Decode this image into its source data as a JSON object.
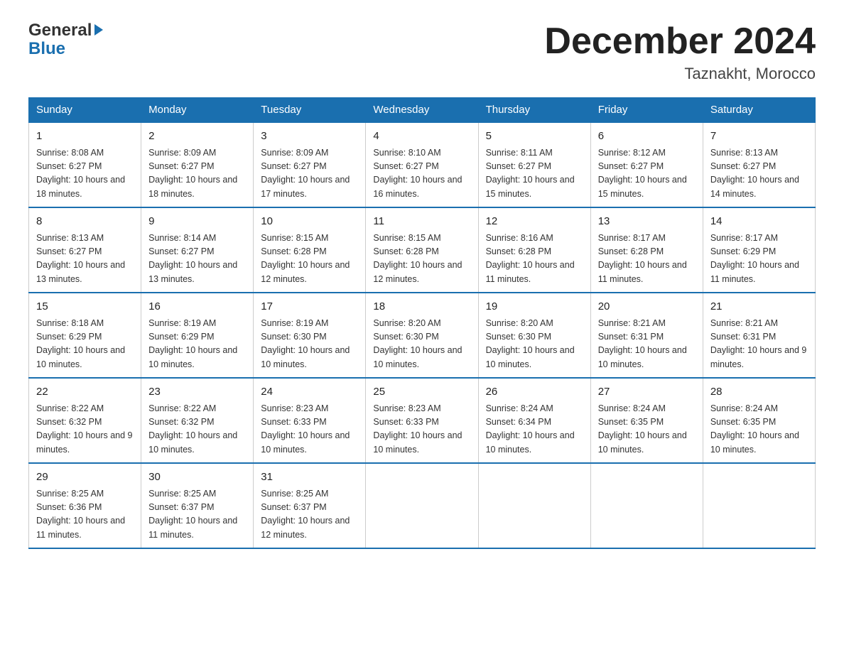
{
  "logo": {
    "line1": "General",
    "triangle": "▶",
    "line2": "Blue"
  },
  "header": {
    "title": "December 2024",
    "location": "Taznakht, Morocco"
  },
  "weekdays": [
    "Sunday",
    "Monday",
    "Tuesday",
    "Wednesday",
    "Thursday",
    "Friday",
    "Saturday"
  ],
  "weeks": [
    [
      {
        "day": "1",
        "sunrise": "8:08 AM",
        "sunset": "6:27 PM",
        "daylight": "10 hours and 18 minutes."
      },
      {
        "day": "2",
        "sunrise": "8:09 AM",
        "sunset": "6:27 PM",
        "daylight": "10 hours and 18 minutes."
      },
      {
        "day": "3",
        "sunrise": "8:09 AM",
        "sunset": "6:27 PM",
        "daylight": "10 hours and 17 minutes."
      },
      {
        "day": "4",
        "sunrise": "8:10 AM",
        "sunset": "6:27 PM",
        "daylight": "10 hours and 16 minutes."
      },
      {
        "day": "5",
        "sunrise": "8:11 AM",
        "sunset": "6:27 PM",
        "daylight": "10 hours and 15 minutes."
      },
      {
        "day": "6",
        "sunrise": "8:12 AM",
        "sunset": "6:27 PM",
        "daylight": "10 hours and 15 minutes."
      },
      {
        "day": "7",
        "sunrise": "8:13 AM",
        "sunset": "6:27 PM",
        "daylight": "10 hours and 14 minutes."
      }
    ],
    [
      {
        "day": "8",
        "sunrise": "8:13 AM",
        "sunset": "6:27 PM",
        "daylight": "10 hours and 13 minutes."
      },
      {
        "day": "9",
        "sunrise": "8:14 AM",
        "sunset": "6:27 PM",
        "daylight": "10 hours and 13 minutes."
      },
      {
        "day": "10",
        "sunrise": "8:15 AM",
        "sunset": "6:28 PM",
        "daylight": "10 hours and 12 minutes."
      },
      {
        "day": "11",
        "sunrise": "8:15 AM",
        "sunset": "6:28 PM",
        "daylight": "10 hours and 12 minutes."
      },
      {
        "day": "12",
        "sunrise": "8:16 AM",
        "sunset": "6:28 PM",
        "daylight": "10 hours and 11 minutes."
      },
      {
        "day": "13",
        "sunrise": "8:17 AM",
        "sunset": "6:28 PM",
        "daylight": "10 hours and 11 minutes."
      },
      {
        "day": "14",
        "sunrise": "8:17 AM",
        "sunset": "6:29 PM",
        "daylight": "10 hours and 11 minutes."
      }
    ],
    [
      {
        "day": "15",
        "sunrise": "8:18 AM",
        "sunset": "6:29 PM",
        "daylight": "10 hours and 10 minutes."
      },
      {
        "day": "16",
        "sunrise": "8:19 AM",
        "sunset": "6:29 PM",
        "daylight": "10 hours and 10 minutes."
      },
      {
        "day": "17",
        "sunrise": "8:19 AM",
        "sunset": "6:30 PM",
        "daylight": "10 hours and 10 minutes."
      },
      {
        "day": "18",
        "sunrise": "8:20 AM",
        "sunset": "6:30 PM",
        "daylight": "10 hours and 10 minutes."
      },
      {
        "day": "19",
        "sunrise": "8:20 AM",
        "sunset": "6:30 PM",
        "daylight": "10 hours and 10 minutes."
      },
      {
        "day": "20",
        "sunrise": "8:21 AM",
        "sunset": "6:31 PM",
        "daylight": "10 hours and 10 minutes."
      },
      {
        "day": "21",
        "sunrise": "8:21 AM",
        "sunset": "6:31 PM",
        "daylight": "10 hours and 9 minutes."
      }
    ],
    [
      {
        "day": "22",
        "sunrise": "8:22 AM",
        "sunset": "6:32 PM",
        "daylight": "10 hours and 9 minutes."
      },
      {
        "day": "23",
        "sunrise": "8:22 AM",
        "sunset": "6:32 PM",
        "daylight": "10 hours and 10 minutes."
      },
      {
        "day": "24",
        "sunrise": "8:23 AM",
        "sunset": "6:33 PM",
        "daylight": "10 hours and 10 minutes."
      },
      {
        "day": "25",
        "sunrise": "8:23 AM",
        "sunset": "6:33 PM",
        "daylight": "10 hours and 10 minutes."
      },
      {
        "day": "26",
        "sunrise": "8:24 AM",
        "sunset": "6:34 PM",
        "daylight": "10 hours and 10 minutes."
      },
      {
        "day": "27",
        "sunrise": "8:24 AM",
        "sunset": "6:35 PM",
        "daylight": "10 hours and 10 minutes."
      },
      {
        "day": "28",
        "sunrise": "8:24 AM",
        "sunset": "6:35 PM",
        "daylight": "10 hours and 10 minutes."
      }
    ],
    [
      {
        "day": "29",
        "sunrise": "8:25 AM",
        "sunset": "6:36 PM",
        "daylight": "10 hours and 11 minutes."
      },
      {
        "day": "30",
        "sunrise": "8:25 AM",
        "sunset": "6:37 PM",
        "daylight": "10 hours and 11 minutes."
      },
      {
        "day": "31",
        "sunrise": "8:25 AM",
        "sunset": "6:37 PM",
        "daylight": "10 hours and 12 minutes."
      },
      null,
      null,
      null,
      null
    ]
  ]
}
